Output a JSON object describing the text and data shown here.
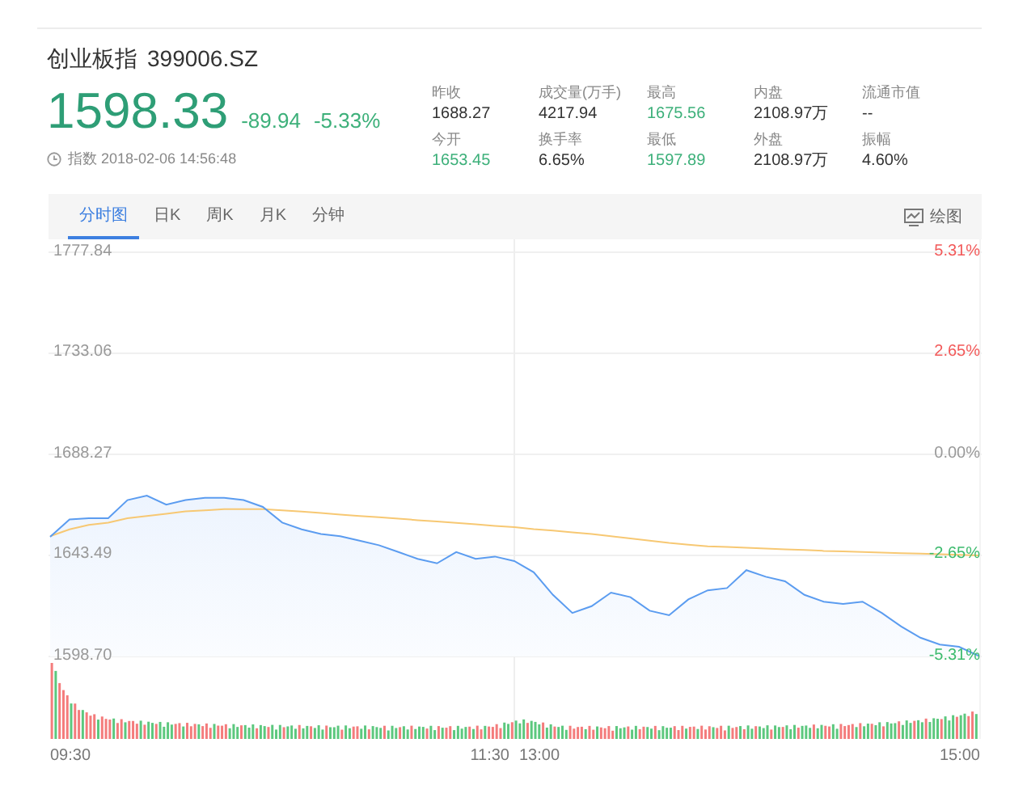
{
  "header": {
    "name": "创业板指",
    "code": "399006.SZ"
  },
  "quote": {
    "price": "1598.33",
    "change": "-89.94",
    "change_pct": "-5.33%",
    "timestamp": "指数 2018-02-06 14:56:48"
  },
  "stats": [
    {
      "label": "昨收",
      "value": "1688.27",
      "color": "#333333"
    },
    {
      "label": "成交量(万手)",
      "value": "4217.94",
      "color": "#333333"
    },
    {
      "label": "最高",
      "value": "1675.56",
      "color": "#3db07a"
    },
    {
      "label": "内盘",
      "value": "2108.97万",
      "color": "#333333"
    },
    {
      "label": "流通市值",
      "value": "--",
      "color": "#333333"
    },
    {
      "label": "今开",
      "value": "1653.45",
      "color": "#3db07a"
    },
    {
      "label": "换手率",
      "value": "6.65%",
      "color": "#333333"
    },
    {
      "label": "最低",
      "value": "1597.89",
      "color": "#3db07a"
    },
    {
      "label": "外盘",
      "value": "2108.97万",
      "color": "#333333"
    },
    {
      "label": "振幅",
      "value": "4.60%",
      "color": "#333333"
    }
  ],
  "tabs": [
    {
      "label": "分时图",
      "selected": true
    },
    {
      "label": "日K",
      "selected": false
    },
    {
      "label": "周K",
      "selected": false
    },
    {
      "label": "月K",
      "selected": false
    },
    {
      "label": "分钟",
      "selected": false
    }
  ],
  "draw_button": {
    "label": "绘图"
  },
  "chart": {
    "right_labels": [
      {
        "text": "5.31%",
        "color": "#f25a5a"
      },
      {
        "text": "2.65%",
        "color": "#f25a5a"
      },
      {
        "text": "0.00%",
        "color": "#999999"
      },
      {
        "text": "-2.65%",
        "color": "#3dbb6e"
      },
      {
        "text": "-5.31%",
        "color": "#3dbb6e"
      }
    ],
    "time_labels": [
      "09:30",
      "11:30",
      "13:00",
      "15:00"
    ],
    "chart_data": {
      "type": "line",
      "grid": true,
      "ylim": [
        1598.7,
        1777.84
      ],
      "yticks": [
        {
          "value": 1777.84,
          "label": "1777.84"
        },
        {
          "value": 1733.06,
          "label": "1733.06"
        },
        {
          "value": 1688.27,
          "label": "1688.27"
        },
        {
          "value": 1643.49,
          "label": "1643.49"
        },
        {
          "value": 1598.7,
          "label": "1598.70"
        }
      ],
      "categories": [
        null,
        null,
        null,
        null,
        null,
        null,
        null,
        null,
        null,
        null,
        null,
        null,
        null,
        null,
        null,
        null,
        null,
        null,
        null,
        null,
        null,
        null,
        null,
        null,
        null,
        null,
        null,
        null,
        null,
        null,
        null,
        null,
        null,
        null,
        null,
        null,
        null,
        null,
        null,
        null,
        null,
        null,
        null,
        null,
        null,
        null,
        null,
        null,
        null
      ],
      "series": [
        {
          "color": "#5b9cf0",
          "values": [
            1651.7,
            1659.5,
            1660,
            1660,
            1668,
            1670,
            1666,
            1668,
            1669,
            1669,
            1668,
            1665,
            1658,
            1655,
            1653,
            1652,
            1650,
            1648,
            1645,
            1642,
            1640,
            1645,
            1642,
            1643,
            1641,
            1636,
            1626,
            1618,
            1621,
            1627,
            1625,
            1619,
            1617,
            1624,
            1628,
            1629,
            1637,
            1634,
            1632,
            1626,
            1623,
            1622,
            1623,
            1618,
            1612,
            1607,
            1604,
            1603,
            1599
          ]
        },
        {
          "color": "#f7c873",
          "values": [
            1652,
            1655,
            1657,
            1658,
            1660,
            1661,
            1662,
            1663,
            1663.5,
            1664,
            1664,
            1664,
            1663.5,
            1662.9,
            1662.3,
            1661.6,
            1661,
            1660.4,
            1659.8,
            1659.1,
            1658.5,
            1657.9,
            1657.3,
            1656.6,
            1656,
            1655.2,
            1654.5,
            1653.7,
            1653,
            1652,
            1651,
            1650,
            1649,
            1648.2,
            1647.5,
            1647.2,
            1646.9,
            1646.5,
            1646.2,
            1645.9,
            1645.5,
            1645.3,
            1645,
            1644.8,
            1644.5,
            1644.3,
            1644,
            1643.8,
            1643.5
          ]
        }
      ]
    }
  }
}
